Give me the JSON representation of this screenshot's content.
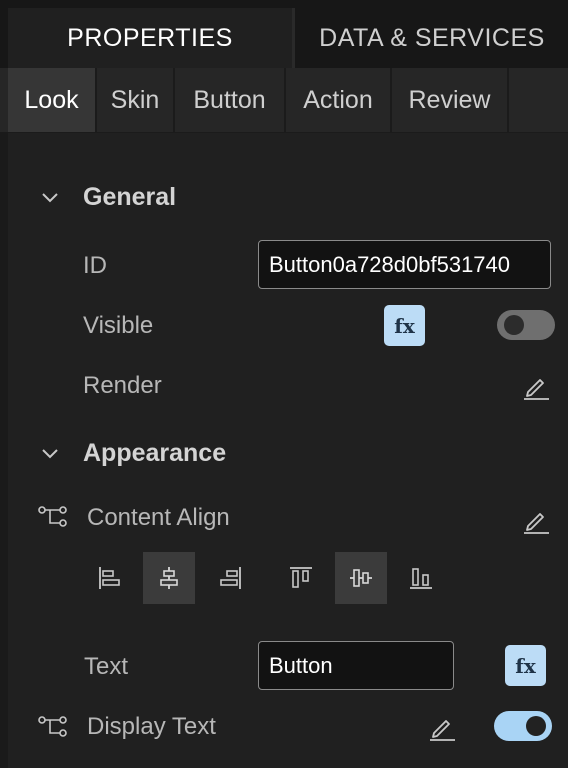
{
  "tabs": {
    "properties": "PROPERTIES",
    "data_services": "DATA & SERVICES"
  },
  "subtabs": [
    "Look",
    "Skin",
    "Button",
    "Action",
    "Review"
  ],
  "general": {
    "title": "General",
    "id_label": "ID",
    "id_value": "Button0a728d0bf531740",
    "visible_label": "Visible",
    "fx_label": "fx",
    "render_label": "Render"
  },
  "appearance": {
    "title": "Appearance",
    "content_align_label": "Content Align",
    "text_label": "Text",
    "text_value": "Button",
    "display_text_label": "Display Text"
  },
  "state": {
    "visible_on": false,
    "display_text_on": true
  },
  "colors": {
    "accent": "#bcdcf6",
    "toggle_on": "#a9d4f5",
    "toggle_off": "#6f6f6f"
  }
}
